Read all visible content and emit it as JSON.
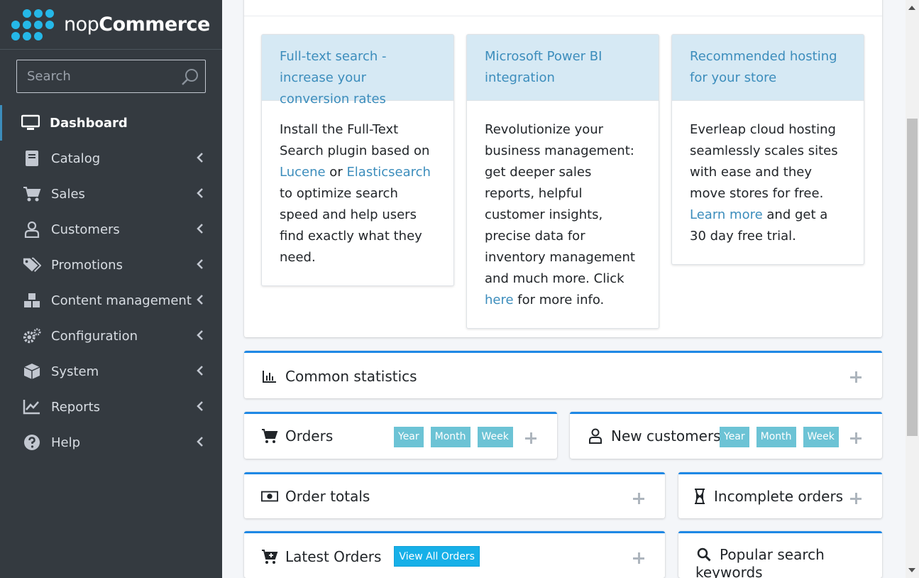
{
  "brand": {
    "name_light": "nop",
    "name_bold": "Commerce"
  },
  "search": {
    "placeholder": "Search"
  },
  "nav": [
    {
      "label": "Dashboard",
      "icon": "monitor-icon",
      "active": true
    },
    {
      "label": "Catalog",
      "icon": "book-icon"
    },
    {
      "label": "Sales",
      "icon": "cart-icon"
    },
    {
      "label": "Customers",
      "icon": "user-icon"
    },
    {
      "label": "Promotions",
      "icon": "tags-icon"
    },
    {
      "label": "Content management",
      "icon": "cubes-icon"
    },
    {
      "label": "Configuration",
      "icon": "gears-icon"
    },
    {
      "label": "System",
      "icon": "cube-icon"
    },
    {
      "label": "Reports",
      "icon": "chart-line-icon"
    },
    {
      "label": "Help",
      "icon": "question-circle-icon"
    }
  ],
  "promos": [
    {
      "title": "Full-text search - increase your conversion rates",
      "body_1": "Install the Full-Text Search plugin based on ",
      "link_1": "Lucene",
      "body_2": " or ",
      "link_2": "Elasticsearch",
      "body_3": " to optimize search speed and help users find exactly what they need."
    },
    {
      "title": "Microsoft Power BI integration",
      "body_1": "Revolutionize your business management: get deeper sales reports, helpful customer insights, precise data for inventory management and much more. Click ",
      "link_1": "here",
      "body_2": " for more info."
    },
    {
      "title": "Recommended hosting for your store",
      "body_1": "Everleap cloud hosting seamlessly scales sites with ease and they move stores for free. ",
      "link_1": "Learn more",
      "body_2": " and get a 30 day free trial."
    }
  ],
  "boxes": {
    "common_statistics": "Common statistics",
    "orders": "Orders",
    "new_customers": "New customers",
    "order_totals": "Order totals",
    "incomplete_orders": "Incomplete orders",
    "latest_orders": "Latest Orders",
    "popular_search": "Popular search keywords",
    "view_all_orders": "View All Orders",
    "period": {
      "year": "Year",
      "month": "Month",
      "week": "Week"
    }
  }
}
